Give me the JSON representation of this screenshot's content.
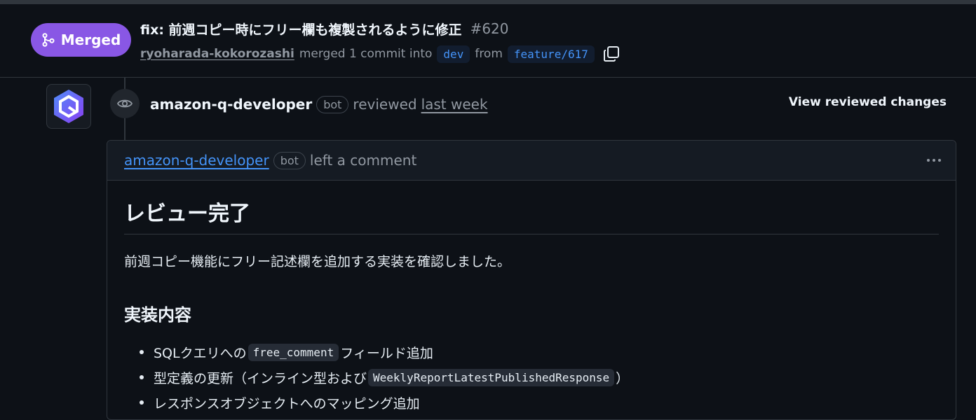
{
  "header": {
    "status": "Merged",
    "title": "fix: 前週コピー時にフリー欄も複製されるように修正",
    "number": "#620",
    "author": "ryoharada-kokorozashi",
    "action": "merged 1 commit into",
    "base_branch": "dev",
    "from_word": "from",
    "head_branch": "feature/617"
  },
  "review": {
    "actor": "amazon-q-developer",
    "bot_label": "bot",
    "action": "reviewed",
    "time": "last week",
    "view_changes": "View reviewed changes"
  },
  "comment": {
    "actor": "amazon-q-developer",
    "bot_label": "bot",
    "action": "left a comment",
    "heading": "レビュー完了",
    "intro": "前週コピー機能にフリー記述欄を追加する実装を確認しました。",
    "section_heading": "実装内容",
    "items": [
      {
        "before": "SQLクエリへの",
        "code": "free_comment",
        "after": "フィールド追加"
      },
      {
        "before": "型定義の更新（インライン型および",
        "code": "WeeklyReportLatestPublishedResponse",
        "after": "）"
      },
      {
        "before": "レスポンスオブジェクトへのマッピング追加",
        "code": "",
        "after": ""
      }
    ]
  },
  "colors": {
    "merged": "#8957e5",
    "link": "#4493f8",
    "background": "#0d1117"
  },
  "icons": {
    "merge": "git-merge-icon",
    "copy": "copy-icon",
    "eye": "eye-icon",
    "more": "kebab-horizontal-icon"
  }
}
